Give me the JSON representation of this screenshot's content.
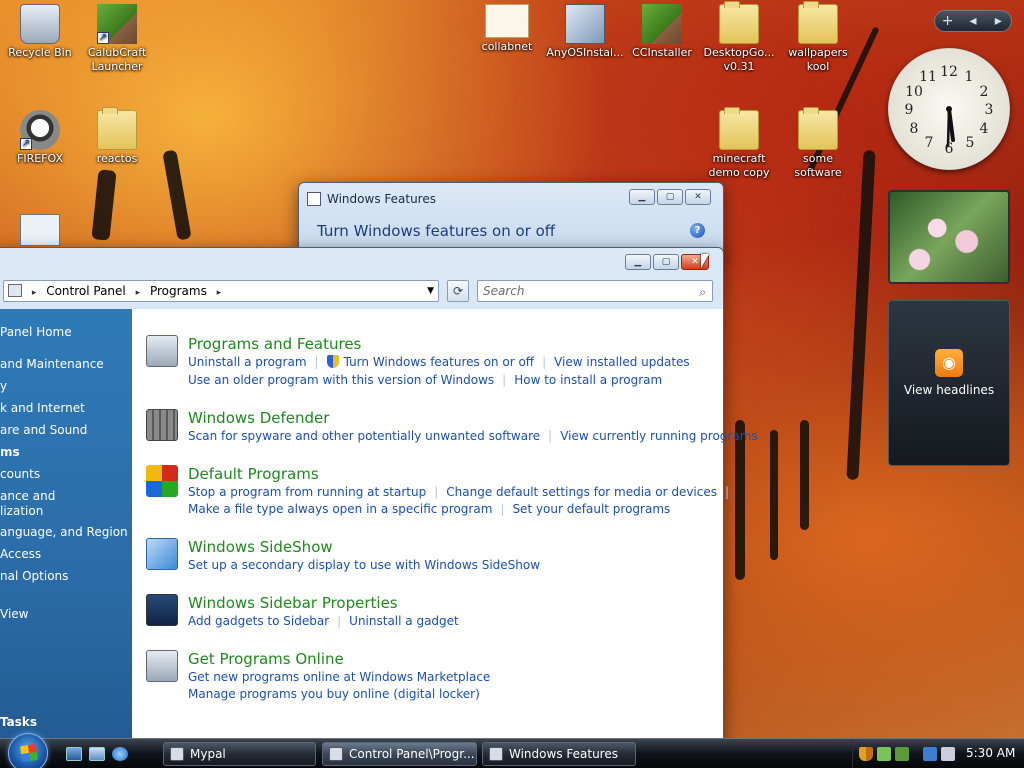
{
  "desktop": {
    "icons": [
      {
        "label": "Recycle Bin"
      },
      {
        "label": "CalubCraft Launcher"
      },
      {
        "label": "FIREFOX"
      },
      {
        "label": "reactos"
      },
      {
        "label": "collabnet"
      },
      {
        "label": "AnyOSInstal..."
      },
      {
        "label": "CCInstaller"
      },
      {
        "label": "DesktopGo... v0.31"
      },
      {
        "label": "wallpapers kool"
      },
      {
        "label": "minecraft demo copy"
      },
      {
        "label": "some software"
      }
    ]
  },
  "sidebar": {
    "top_add": "+",
    "top_prev": "◂",
    "top_next": "▸",
    "feed_icon": "rss-icon",
    "feed_label": "View headlines"
  },
  "windows_features": {
    "title": "Windows Features",
    "heading": "Turn Windows features on or off",
    "help": "?"
  },
  "control_panel": {
    "breadcrumb": [
      "Control Panel",
      "Programs"
    ],
    "search_placeholder": "Search",
    "left_nav": [
      "Panel Home",
      "and Maintenance",
      "y",
      "k and Internet",
      "are and Sound",
      "ms",
      "counts",
      "ance and",
      "lization",
      "anguage, and Region",
      "Access",
      "nal Options",
      "View",
      "Tasks"
    ],
    "sections": [
      {
        "title": "Programs and Features",
        "icon": "programs-icon",
        "rows": [
          [
            "Uninstall a program",
            "Turn Windows features on or off",
            "View installed updates"
          ],
          [
            "Use an older program with this version of Windows",
            "How to install a program"
          ]
        ]
      },
      {
        "title": "Windows Defender",
        "icon": "defender-icon",
        "rows": [
          [
            "Scan for spyware and other potentially unwanted software",
            "View currently running programs"
          ]
        ]
      },
      {
        "title": "Default Programs",
        "icon": "default-programs-icon",
        "rows": [
          [
            "Stop a program from running at startup",
            "Change default settings for media or devices"
          ],
          [
            "Make a file type always open in a specific program",
            "Set your default programs"
          ]
        ]
      },
      {
        "title": "Windows SideShow",
        "icon": "sideshow-icon",
        "rows": [
          [
            "Set up a secondary display to use with Windows SideShow"
          ]
        ]
      },
      {
        "title": "Windows Sidebar Properties",
        "icon": "sidebar-icon",
        "rows": [
          [
            "Add gadgets to Sidebar",
            "Uninstall a gadget"
          ]
        ]
      },
      {
        "title": "Get Programs Online",
        "icon": "online-icon",
        "rows": [
          [
            "Get new programs online at Windows Marketplace"
          ],
          [
            "Manage programs you buy online (digital locker)"
          ]
        ]
      }
    ]
  },
  "taskbar": {
    "buttons": [
      "Mypal",
      "Control Panel\\Progr...",
      "Windows Features"
    ],
    "time": "5:30 AM"
  }
}
